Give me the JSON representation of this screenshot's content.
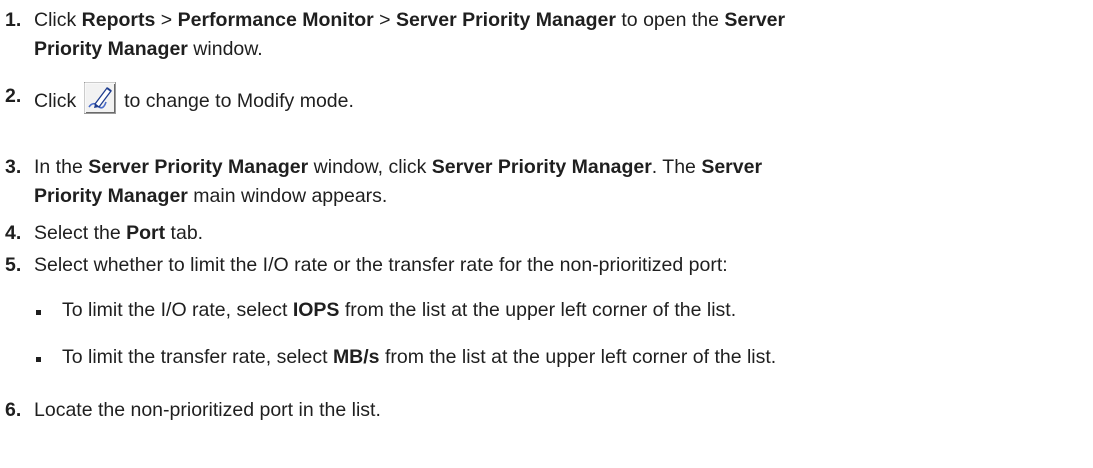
{
  "steps": [
    {
      "num": "1.",
      "parts": [
        "Click ",
        "Reports",
        " > ",
        "Performance Monitor",
        " > ",
        "Server Priority Manager",
        " to open the ",
        "Server",
        "Priority Manager",
        " window."
      ]
    },
    {
      "num": "2.",
      "before": "Click ",
      "icon": "modify-pen-icon",
      "after": " to change to Modify mode."
    },
    {
      "num": "3.",
      "parts": [
        "In the ",
        "Server Priority Manager",
        " window, click ",
        "Server Priority Manager",
        ". The ",
        "Server",
        "Priority Manager",
        " main window appears."
      ]
    },
    {
      "num": "4.",
      "parts": [
        "Select the ",
        "Port",
        " tab."
      ]
    },
    {
      "num": "5.",
      "text": "Select whether to limit the I/O rate or the transfer rate for the non-prioritized port:",
      "bullets": [
        {
          "before": "To limit the I/O rate, select ",
          "bold": "IOPS",
          "after": " from the list at the upper left corner of the list."
        },
        {
          "before": "To limit the transfer rate, select ",
          "bold": "MB/s",
          "after": " from the list at the upper left corner of the list."
        }
      ]
    },
    {
      "num": "6.",
      "text": "Locate the non-prioritized port in the list."
    }
  ]
}
